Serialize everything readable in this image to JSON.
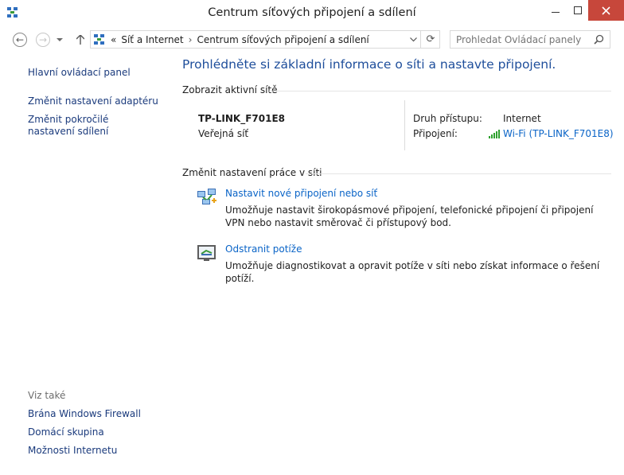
{
  "window": {
    "title": "Centrum síťových připojení a sdílení"
  },
  "navigation": {
    "breadcrumb_prefix": "«",
    "breadcrumb": [
      "Síť a Internet",
      "Centrum síťových připojení a sdílení"
    ],
    "breadcrumb_separator": "›",
    "search_placeholder": "Prohledat Ovládací panely"
  },
  "sidebar": {
    "home_link": "Hlavní ovládací panel",
    "links": [
      "Změnit nastavení adaptéru",
      "Změnit pokročilé nastavení sdílení"
    ],
    "see_also_heading": "Viz také",
    "see_also": [
      "Brána Windows Firewall",
      "Domácí skupina",
      "Možnosti Internetu"
    ]
  },
  "main": {
    "heading": "Prohlédněte si základní informace o síti a nastavte připojení.",
    "active_networks_label": "Zobrazit aktivní sítě",
    "network": {
      "name": "TP-LINK_F701E8",
      "type": "Veřejná síť",
      "access_label": "Druh přístupu:",
      "access_value": "Internet",
      "connection_label": "Připojení:",
      "connection_value": "Wi-Fi (TP-LINK_F701E8)"
    },
    "change_settings_label": "Změnit nastavení práce v síti",
    "tasks": [
      {
        "title": "Nastavit nové připojení nebo síť",
        "description": "Umožňuje nastavit širokopásmové připojení, telefonické připojení či připojení VPN nebo nastavit směrovač či přístupový bod.",
        "icon": "new-connection-icon"
      },
      {
        "title": "Odstranit potíže",
        "description": "Umožňuje diagnostikovat a opravit potíže v síti nebo získat informace o řešení potíží.",
        "icon": "troubleshoot-icon"
      }
    ]
  },
  "colors": {
    "heading": "#1e4e9b",
    "link": "#0a64c7",
    "sidebar_link": "#1a3a7c",
    "muted": "#6d6d6d",
    "wifi_green": "#2fa12f"
  }
}
